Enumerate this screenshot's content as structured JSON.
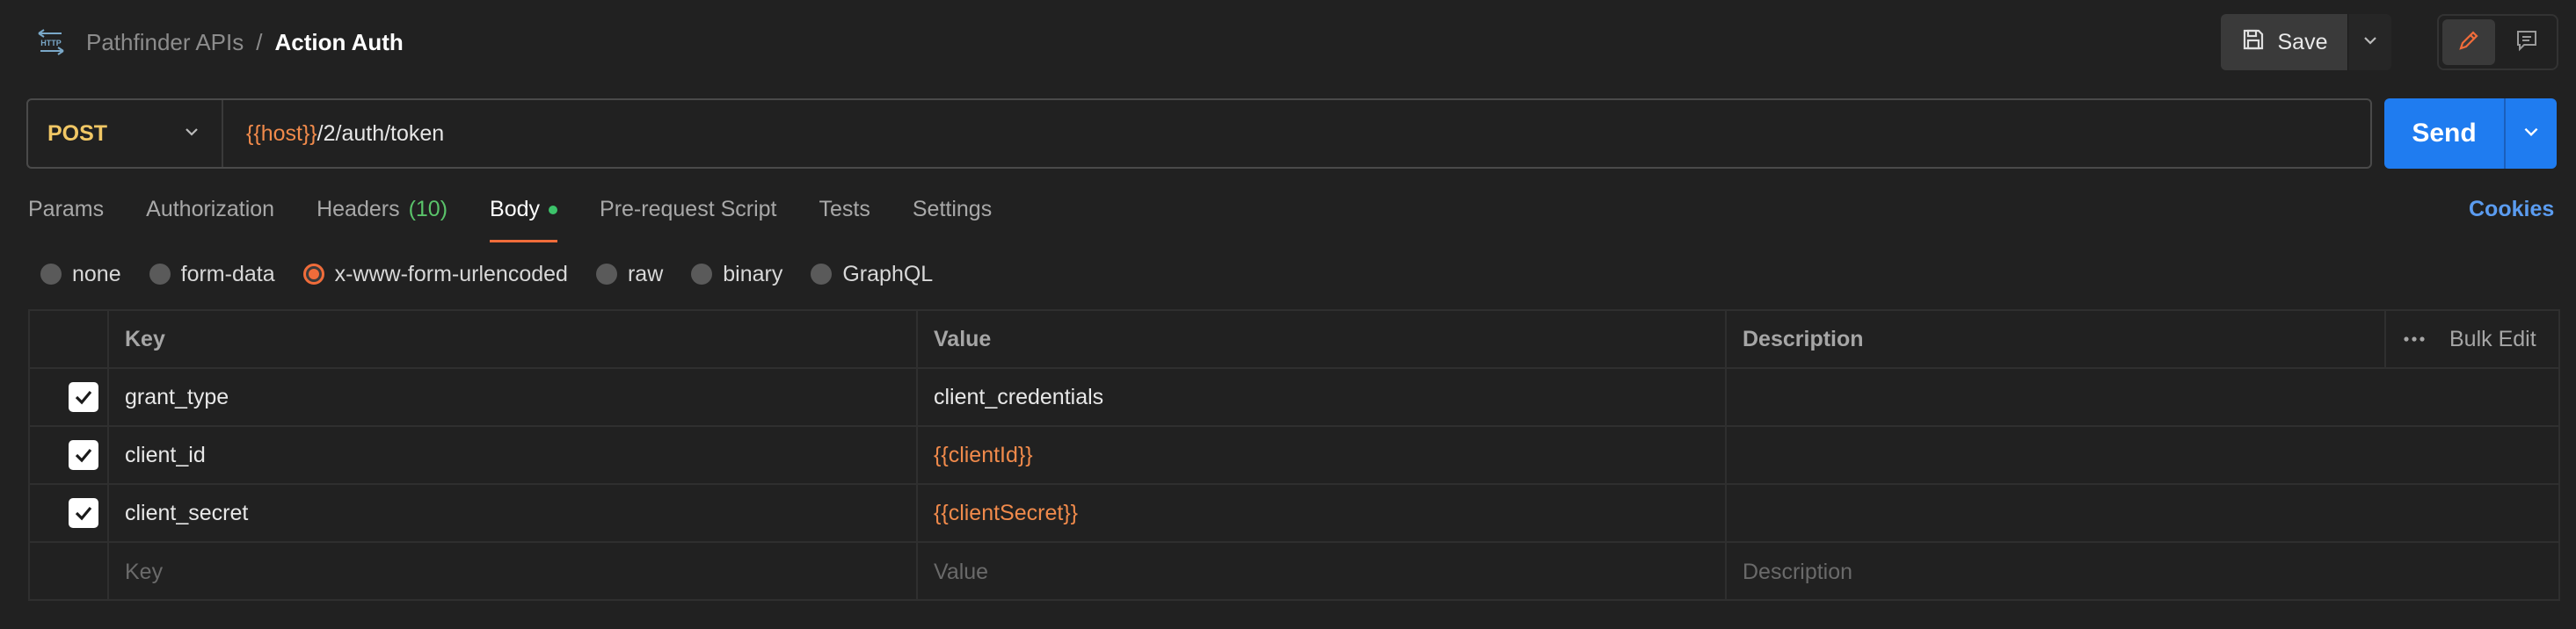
{
  "header": {
    "icon": "http-icon",
    "breadcrumb_parent": "Pathfinder APIs",
    "breadcrumb_sep": "/",
    "breadcrumb_current": "Action Auth",
    "save_label": "Save"
  },
  "request": {
    "method": "POST",
    "url_var": "{{host}}",
    "url_path": "/2/auth/token",
    "send_label": "Send"
  },
  "tabs": [
    {
      "label": "Params"
    },
    {
      "label": "Authorization"
    },
    {
      "label": "Headers",
      "count": "(10)"
    },
    {
      "label": "Body",
      "active": true,
      "dot": true
    },
    {
      "label": "Pre-request Script"
    },
    {
      "label": "Tests"
    },
    {
      "label": "Settings"
    }
  ],
  "cookies_label": "Cookies",
  "body_types": [
    {
      "label": "none"
    },
    {
      "label": "form-data"
    },
    {
      "label": "x-www-form-urlencoded",
      "selected": true
    },
    {
      "label": "raw"
    },
    {
      "label": "binary"
    },
    {
      "label": "GraphQL"
    }
  ],
  "table": {
    "headers": {
      "key": "Key",
      "value": "Value",
      "description": "Description",
      "bulk_edit": "Bulk Edit"
    },
    "rows": [
      {
        "checked": true,
        "key": "grant_type",
        "value": "client_credentials",
        "value_is_var": false,
        "description": ""
      },
      {
        "checked": true,
        "key": "client_id",
        "value": "{{clientId}}",
        "value_is_var": true,
        "description": ""
      },
      {
        "checked": true,
        "key": "client_secret",
        "value": "{{clientSecret}}",
        "value_is_var": true,
        "description": ""
      }
    ],
    "placeholders": {
      "key": "Key",
      "value": "Value",
      "description": "Description"
    }
  },
  "colors": {
    "accent": "#f06c3a",
    "variable": "#f08a4b",
    "method": "#f1c765",
    "send": "#1f7cf0",
    "link": "#5b9cf0",
    "count": "#5ac36a"
  }
}
